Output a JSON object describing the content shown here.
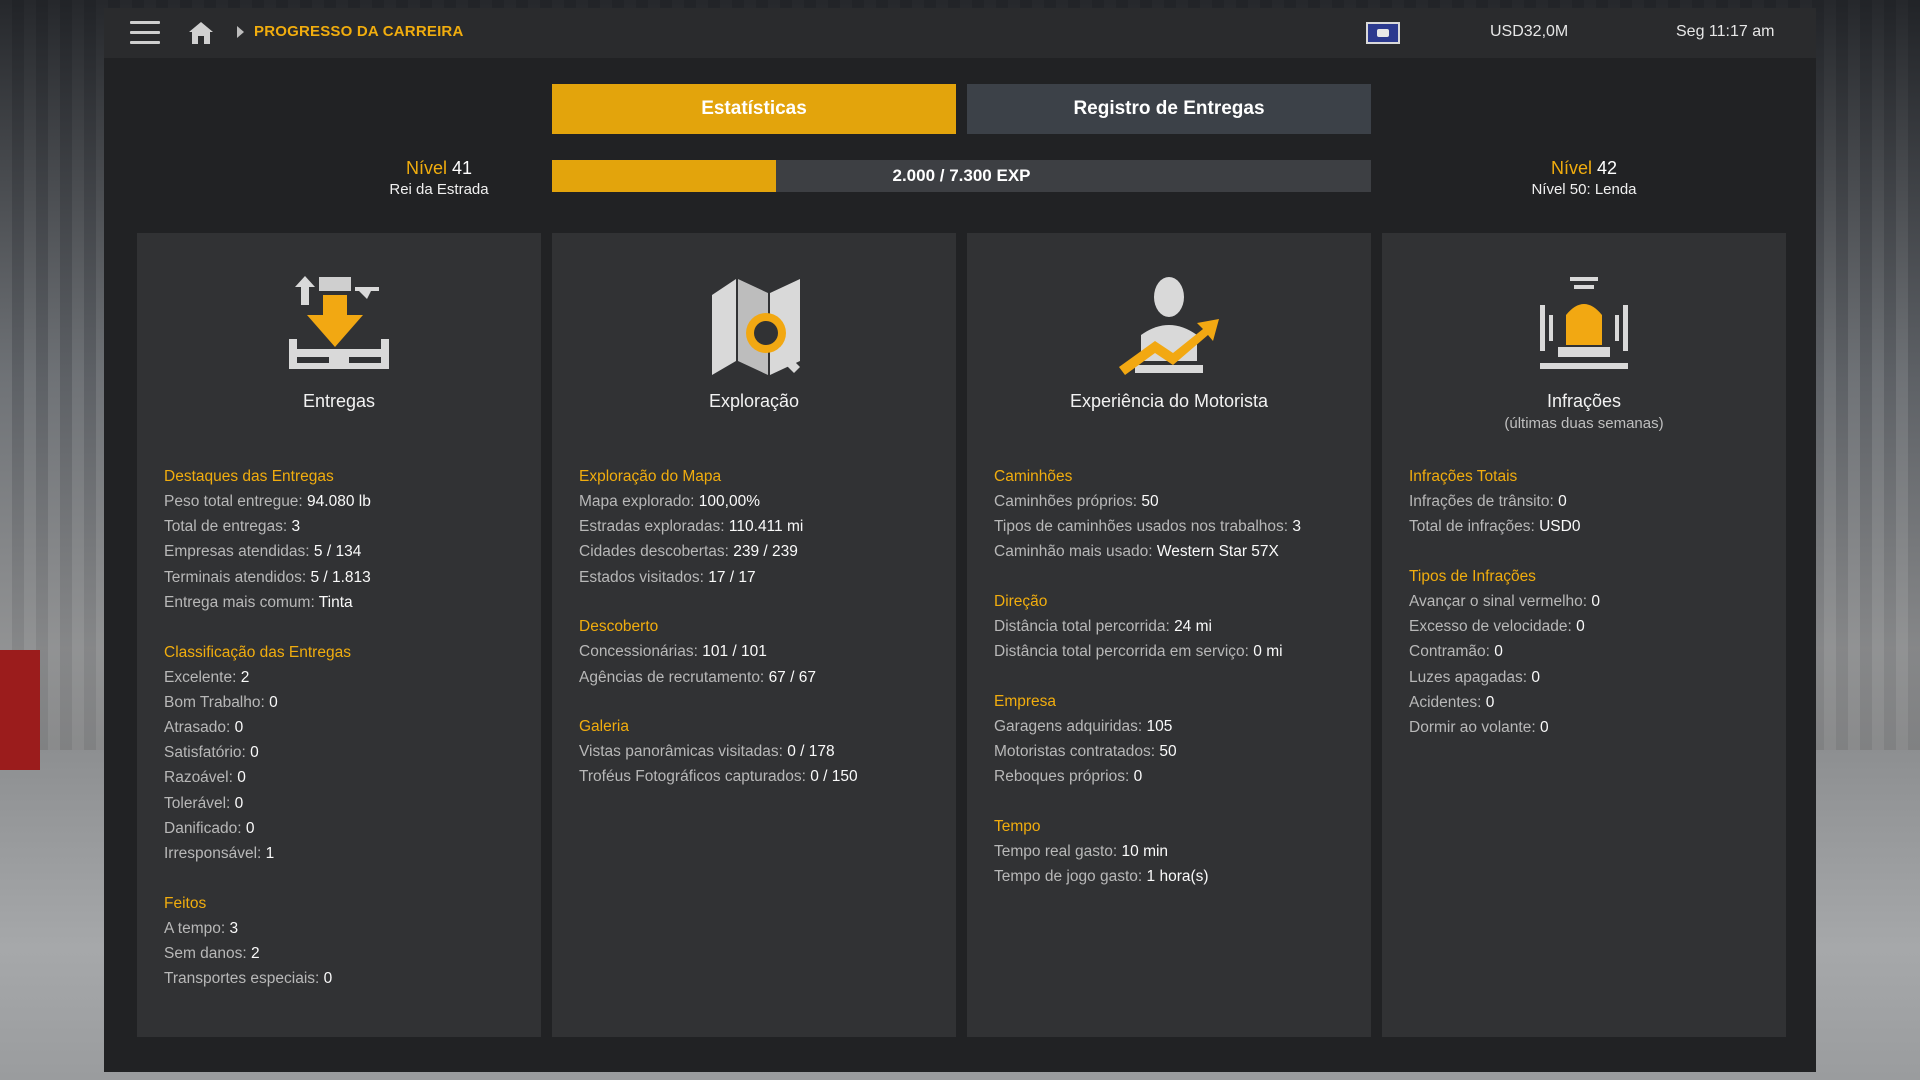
{
  "topbar": {
    "breadcrumb": "PROGRESSO DA CARREIRA",
    "money": "USD32,0M",
    "clock": "Seg 11:17 am"
  },
  "tabs": [
    {
      "label": "Estatísticas",
      "active": true
    },
    {
      "label": "Registro de Entregas",
      "active": false
    }
  ],
  "level_current": {
    "label": "Nível",
    "number": "41",
    "title": "Rei da Estrada"
  },
  "level_next": {
    "label": "Nível",
    "number": "42",
    "title": "Nível 50: Lenda"
  },
  "xp": {
    "text": "2.000 / 7.300 EXP",
    "current": 2000,
    "total": 7300
  },
  "colors": {
    "accent": "#e3a40c",
    "panel": "#313234",
    "background": "#212224"
  },
  "cards": [
    {
      "title": "Entregas",
      "subtitle": "",
      "icon": "delivery-icon",
      "sections": [
        {
          "title": "Destaques das Entregas",
          "rows": [
            {
              "label": "Peso total entregue: ",
              "value": "94.080 lb"
            },
            {
              "label": "Total de entregas: ",
              "value": "3"
            },
            {
              "label": "Empresas atendidas: ",
              "value": "5 / 134"
            },
            {
              "label": "Terminais atendidos: ",
              "value": "5 / 1.813"
            },
            {
              "label": "Entrega mais comum: ",
              "value": "Tinta"
            }
          ]
        },
        {
          "title": "Classificação das Entregas",
          "rows": [
            {
              "label": "Excelente: ",
              "value": "2"
            },
            {
              "label": "Bom Trabalho: ",
              "value": "0"
            },
            {
              "label": "Atrasado: ",
              "value": "0"
            },
            {
              "label": "Satisfatório: ",
              "value": "0"
            },
            {
              "label": "Razoável: ",
              "value": "0"
            },
            {
              "label": "Tolerável: ",
              "value": "0"
            },
            {
              "label": "Danificado: ",
              "value": "0"
            },
            {
              "label": "Irresponsável: ",
              "value": "1"
            }
          ]
        },
        {
          "title": "Feitos",
          "rows": [
            {
              "label": "A tempo: ",
              "value": "3"
            },
            {
              "label": "Sem danos: ",
              "value": "2"
            },
            {
              "label": "Transportes especiais: ",
              "value": "0"
            }
          ]
        }
      ]
    },
    {
      "title": "Exploração",
      "subtitle": "",
      "icon": "map-search-icon",
      "sections": [
        {
          "title": "Exploração do Mapa",
          "rows": [
            {
              "label": "Mapa explorado: ",
              "value": "100,00%"
            },
            {
              "label": "Estradas exploradas: ",
              "value": "110.411 mi"
            },
            {
              "label": "Cidades descobertas: ",
              "value": "239 / 239"
            },
            {
              "label": "Estados visitados: ",
              "value": "17 / 17"
            }
          ]
        },
        {
          "title": "Descoberto",
          "rows": [
            {
              "label": "Concessionárias: ",
              "value": "101 / 101"
            },
            {
              "label": "Agências de recrutamento: ",
              "value": "67 / 67"
            }
          ]
        },
        {
          "title": "Galeria",
          "rows": [
            {
              "label": "Vistas panorâmicas visitadas: ",
              "value": "0 / 178"
            },
            {
              "label": "Troféus Fotográficos capturados: ",
              "value": "0 / 150"
            }
          ]
        }
      ]
    },
    {
      "title": "Experiência do Motorista",
      "subtitle": "",
      "icon": "driver-growth-icon",
      "sections": [
        {
          "title": "Caminhões",
          "rows": [
            {
              "label": "Caminhões próprios: ",
              "value": "50"
            },
            {
              "label": "Tipos de caminhões usados nos trabalhos: ",
              "value": "3"
            },
            {
              "label": "Caminhão mais usado: ",
              "value": "Western Star 57X"
            }
          ]
        },
        {
          "title": "Direção",
          "rows": [
            {
              "label": "Distância total percorrida: ",
              "value": "24 mi"
            },
            {
              "label": "Distância total percorrida em serviço: ",
              "value": "0 mi"
            }
          ]
        },
        {
          "title": "Empresa",
          "rows": [
            {
              "label": "Garagens adquiridas: ",
              "value": "105"
            },
            {
              "label": "Motoristas contratados: ",
              "value": "50"
            },
            {
              "label": "Reboques próprios: ",
              "value": "0"
            }
          ]
        },
        {
          "title": "Tempo",
          "rows": [
            {
              "label": "Tempo real gasto: ",
              "value": "10 min"
            },
            {
              "label": "Tempo de jogo gasto: ",
              "value": "1 hora(s)"
            }
          ]
        }
      ]
    },
    {
      "title": "Infrações",
      "subtitle": "(últimas duas semanas)",
      "icon": "alarm-siren-icon",
      "sections": [
        {
          "title": "Infrações Totais",
          "rows": [
            {
              "label": "Infrações de trânsito: ",
              "value": "0"
            },
            {
              "label": "Total de infrações: ",
              "value": "USD0"
            }
          ]
        },
        {
          "title": "Tipos de Infrações",
          "rows": [
            {
              "label": "Avançar o sinal vermelho: ",
              "value": "0"
            },
            {
              "label": "Excesso de velocidade: ",
              "value": "0"
            },
            {
              "label": "Contramão: ",
              "value": "0"
            },
            {
              "label": "Luzes apagadas: ",
              "value": "0"
            },
            {
              "label": "Acidentes: ",
              "value": "0"
            },
            {
              "label": "Dormir ao volante: ",
              "value": "0"
            }
          ]
        }
      ]
    }
  ]
}
